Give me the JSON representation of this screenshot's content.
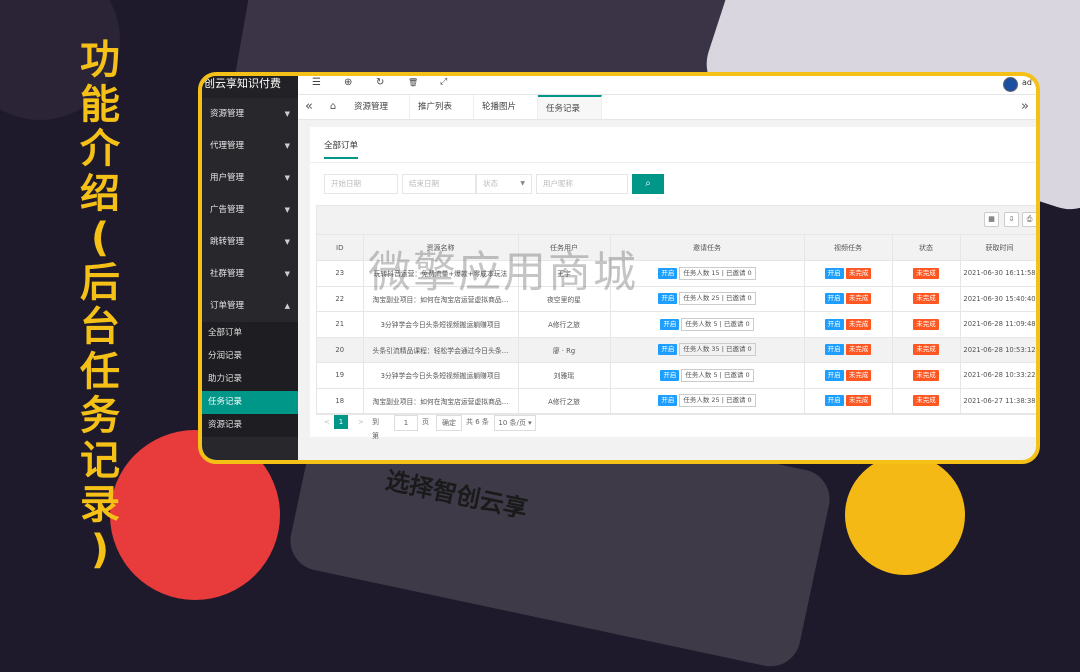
{
  "promo": {
    "vertical_title_chars": [
      "功",
      "能",
      "介",
      "绍",
      "(",
      "后",
      "台",
      "任",
      "务",
      "记",
      "录",
      ")"
    ],
    "bottom_text": "选择智创云享",
    "watermark": "微擎应用商城"
  },
  "colors": {
    "accent": "#f5c116",
    "primary": "#009688",
    "blue_badge": "#1e9fff",
    "orange_badge": "#ff5722"
  },
  "sidebar": {
    "brand": "创云享知识付费",
    "items": [
      {
        "label": "资源管理",
        "icon": "chevron-down-icon"
      },
      {
        "label": "代理管理",
        "icon": "chevron-down-icon"
      },
      {
        "label": "用户管理",
        "icon": "chevron-down-icon"
      },
      {
        "label": "广告管理",
        "icon": "chevron-down-icon"
      },
      {
        "label": "跳转管理",
        "icon": "chevron-down-icon"
      },
      {
        "label": "社群管理",
        "icon": "chevron-down-icon"
      },
      {
        "label": "订单管理",
        "icon": "chevron-up-icon"
      }
    ],
    "sub_items": [
      "全部订单",
      "分润记录",
      "助力记录",
      "任务记录",
      "资源记录"
    ]
  },
  "topbar": {
    "icons": [
      "menu-icon",
      "globe-icon",
      "refresh-icon",
      "trash-icon",
      "fullscreen-icon"
    ],
    "user": "ad"
  },
  "tabs": [
    {
      "label": "资源管理"
    },
    {
      "label": "推广列表"
    },
    {
      "label": "轮播图片"
    },
    {
      "label": "任务记录"
    }
  ],
  "content": {
    "subtab": "全部订单",
    "filters": {
      "start_date": "开始日期",
      "end_date": "结束日期",
      "status": "状态",
      "nickname": "用户昵称"
    },
    "table": {
      "headers": [
        "ID",
        "资源名称",
        "任务用户",
        "邀请任务",
        "视频任务",
        "状态",
        "获取时间"
      ],
      "rows": [
        {
          "id": "23",
          "name": "玩转抖音运营：免费流量+爆款+零成本玩法",
          "user": "王宇",
          "invite": "任务人数 15 | 已邀请 0",
          "time": "2021-06-30 16:11:58"
        },
        {
          "id": "22",
          "name": "淘宝副业项目：如何在淘宝店运营虚拟商品…",
          "user": "夜空里的星",
          "invite": "任务人数 25 | 已邀请 0",
          "time": "2021-06-30 15:40:40"
        },
        {
          "id": "21",
          "name": "3分钟学会今日头条短视频搬运躺赚项目",
          "user": "A修行之旅",
          "invite": "任务人数 5 | 已邀请 0",
          "time": "2021-06-28 11:09:48"
        },
        {
          "id": "20",
          "name": "头条引流精品课程：轻松学会通过今日头条…",
          "user": "廖 · Rg",
          "invite": "任务人数 35 | 已邀请 0",
          "time": "2021-06-28 10:53:12"
        },
        {
          "id": "19",
          "name": "3分钟学会今日头条短视频搬运躺赚项目",
          "user": "刘雅瑶",
          "invite": "任务人数 5 | 已邀请 0",
          "time": "2021-06-28 10:33:22"
        },
        {
          "id": "18",
          "name": "淘宝副业项目：如何在淘宝店运营虚拟商品…",
          "user": "A修行之旅",
          "invite": "任务人数 25 | 已邀请 0",
          "time": "2021-06-27 11:38:38"
        }
      ],
      "badge_open": "开启",
      "badge_incomplete": "未完成"
    },
    "pager": {
      "current": "1",
      "goto": "到第",
      "page_input": "1",
      "page_unit": "页",
      "confirm": "确定",
      "total": "共 6 条",
      "per_page": "10 条/页"
    }
  }
}
